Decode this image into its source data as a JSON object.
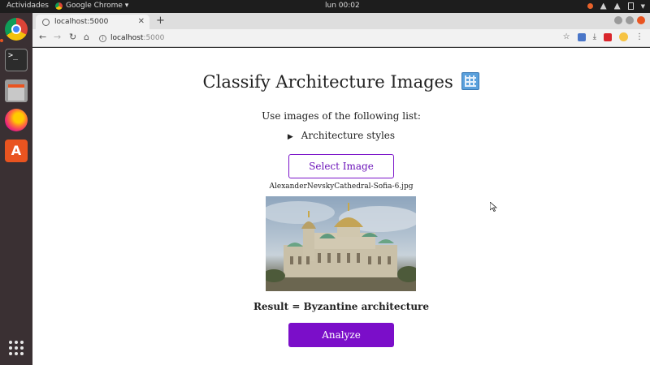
{
  "os": {
    "activities": "Actividades",
    "app_menu": "Google Chrome ▾",
    "clock": "lun 00:02"
  },
  "browser": {
    "tab_title": "localhost:5000",
    "url_host": "localhost",
    "url_port": ":5000"
  },
  "page": {
    "title": "Classify Architecture Images",
    "title_icon": "office-building-emoji",
    "subtitle": "Use images of the following list:",
    "details_summary": "Architecture styles",
    "select_label": "Select Image",
    "filename": "AlexanderNevskyCathedral-Sofia-6.jpg",
    "result": "Result = Byzantine architecture",
    "analyze_label": "Analyze"
  },
  "colors": {
    "accent": "#7b0ec9",
    "ubuntu_orange": "#e95420"
  }
}
